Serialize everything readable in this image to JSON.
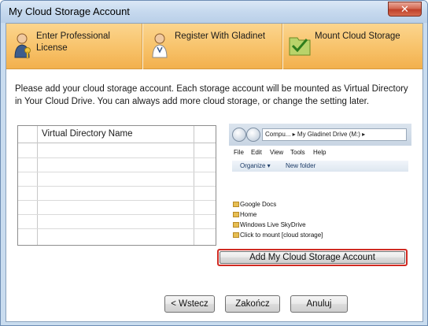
{
  "window": {
    "title": "My Cloud Storage Account",
    "close_label": "✕"
  },
  "steps": [
    {
      "label": "Enter Professional License",
      "icon": "person-key-icon"
    },
    {
      "label": "Register With Gladinet",
      "icon": "person-doctor-icon"
    },
    {
      "label": "Mount Cloud Storage",
      "icon": "mount-folder-icon"
    }
  ],
  "instructions": "Please add your cloud storage account. Each storage account will be mounted as Virtual Directory in Your Cloud Drive. You can always add more cloud storage, or change the setting later.",
  "grid": {
    "column_header": "Virtual Directory Name"
  },
  "preview": {
    "address": "Compu... ▸ My Gladinet Drive (M:) ▸",
    "menu": [
      "File",
      "Edit",
      "View",
      "Tools",
      "Help"
    ],
    "toolbar": [
      "Organize ▾",
      "New folder"
    ],
    "items": [
      "Google Docs",
      "Home",
      "Windows Live SkyDrive",
      "Click to mount [cloud storage]"
    ]
  },
  "add_button_label": "Add My Cloud Storage Account",
  "buttons": {
    "back": "< Wstecz",
    "finish": "Zakończ",
    "cancel": "Anuluj"
  },
  "colors": {
    "step_banner": "#f8c46d",
    "highlight_border": "#d02a22",
    "window_frame": "#c9dcef"
  }
}
